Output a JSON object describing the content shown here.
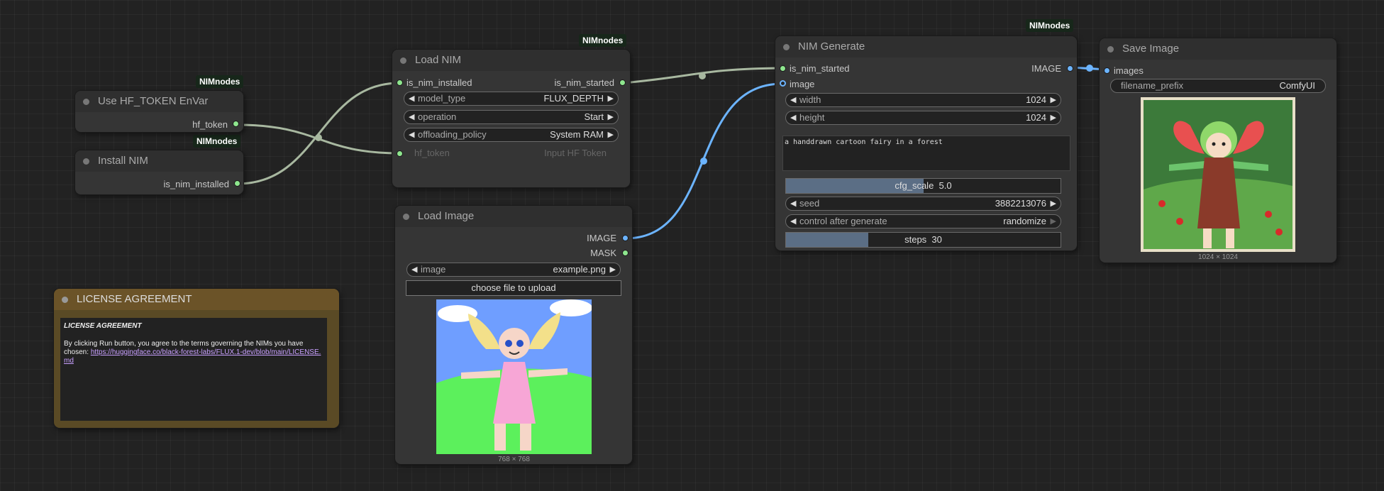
{
  "badges": {
    "hf": "NIMnodes",
    "install": "NIMnodes",
    "load": "NIMnodes",
    "gen": "NIMnodes"
  },
  "hf_node": {
    "title": "Use HF_TOKEN EnVar",
    "output": "hf_token"
  },
  "install_node": {
    "title": "Install NIM",
    "output": "is_nim_installed"
  },
  "load_nim": {
    "title": "Load NIM",
    "input": "is_nim_installed",
    "output": "is_nim_started",
    "widgets": [
      {
        "label": "model_type",
        "value": "FLUX_DEPTH"
      },
      {
        "label": "operation",
        "value": "Start"
      },
      {
        "label": "offloading_policy",
        "value": "System RAM"
      },
      {
        "label": "hf_token",
        "value": "Input HF Token"
      }
    ]
  },
  "load_image": {
    "title": "Load Image",
    "outputs": [
      "IMAGE",
      "MASK"
    ],
    "image_label": "image",
    "image_value": "example.png",
    "upload_label": "choose file to upload",
    "caption": "768 × 768"
  },
  "nim_generate": {
    "title": "NIM Generate",
    "inputs": [
      "is_nim_started",
      "image"
    ],
    "output": "IMAGE",
    "width_label": "width",
    "width": "1024",
    "height_label": "height",
    "height": "1024",
    "prompt": "a handdrawn cartoon fairy in a forest",
    "cfg_label": "cfg_scale",
    "cfg_value": "5.0",
    "cfg_fill": 0.5,
    "seed_label": "seed",
    "seed": "3882213076",
    "control_label": "control after generate",
    "control_value": "randomize",
    "steps_label": "steps",
    "steps_value": "30",
    "steps_fill": 0.3
  },
  "save_image": {
    "title": "Save Image",
    "input": "images",
    "prefix_label": "filename_prefix",
    "prefix_value": "ComfyUI",
    "caption": "1024 × 1024"
  },
  "license": {
    "title": "LICENSE AGREEMENT",
    "heading": "LICENSE AGREEMENT",
    "text": "By clicking Run button, you agree to the terms governing the NIMs you have chosen: ",
    "link": "https://huggingface.co/black-forest-labs/FLUX.1-dev/blob/main/LICENSE.md"
  },
  "colors": {
    "canvas": "#222222",
    "node": "#353535",
    "title_bar": "#2f2f2f",
    "link_green": "#a8b8a0",
    "link_blue": "#6cb4ff",
    "license_bg": "#5a4a25",
    "license_title": "#6b5328"
  }
}
